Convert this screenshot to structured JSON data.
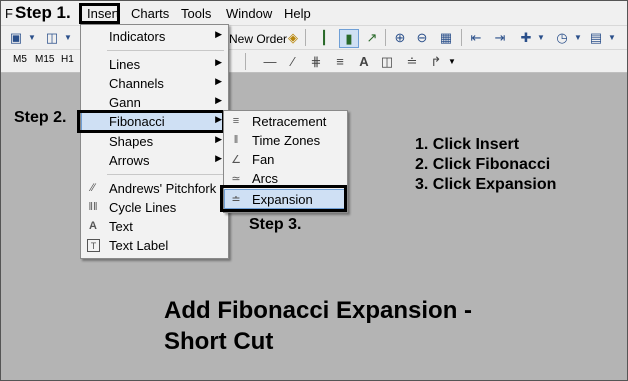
{
  "menubar": {
    "app_letter": "F",
    "step1": "Step 1.",
    "items": [
      "Insert",
      "Charts",
      "Tools",
      "Window",
      "Help"
    ]
  },
  "toolbar": {
    "new_order": "New Order",
    "timeframes": [
      "M5",
      "M15",
      "H1"
    ]
  },
  "insert_menu": {
    "items": [
      {
        "label": "Indicators",
        "icon": "none",
        "submenu": true
      },
      {
        "label": "Lines",
        "icon": "none",
        "submenu": true
      },
      {
        "label": "Channels",
        "icon": "none",
        "submenu": true
      },
      {
        "label": "Gann",
        "icon": "none",
        "submenu": true
      },
      {
        "label": "Fibonacci",
        "icon": "none",
        "submenu": true,
        "highlighted": true
      },
      {
        "label": "Shapes",
        "icon": "none",
        "submenu": true
      },
      {
        "label": "Arrows",
        "icon": "none",
        "submenu": true
      },
      {
        "label": "Andrews' Pitchfork",
        "icon": "pitchfork-icon",
        "submenu": false
      },
      {
        "label": "Cycle Lines",
        "icon": "cycle-lines-icon",
        "submenu": false
      },
      {
        "label": "Text",
        "icon": "text-icon",
        "submenu": false
      },
      {
        "label": "Text Label",
        "icon": "text-label-icon",
        "submenu": false
      }
    ]
  },
  "fibonacci_menu": {
    "items": [
      {
        "label": "Retracement",
        "icon": "retracement-icon"
      },
      {
        "label": "Time Zones",
        "icon": "time-zones-icon"
      },
      {
        "label": "Fan",
        "icon": "fan-icon"
      },
      {
        "label": "Arcs",
        "icon": "arcs-icon"
      },
      {
        "label": "Expansion",
        "icon": "expansion-icon",
        "highlighted": true
      }
    ]
  },
  "annotations": {
    "step2": "Step 2.",
    "step3": "Step 3.",
    "instructions": [
      "1. Click Insert",
      "2. Click Fibonacci",
      "3. Click Expansion"
    ],
    "title_line1": "Add Fibonacci Expansion -",
    "title_line2": "Short Cut"
  },
  "colors": {
    "chart_background": "#b4b4b4",
    "menu_highlight": "#cfe0f4",
    "menu_highlight_border": "#6f9fd6"
  }
}
